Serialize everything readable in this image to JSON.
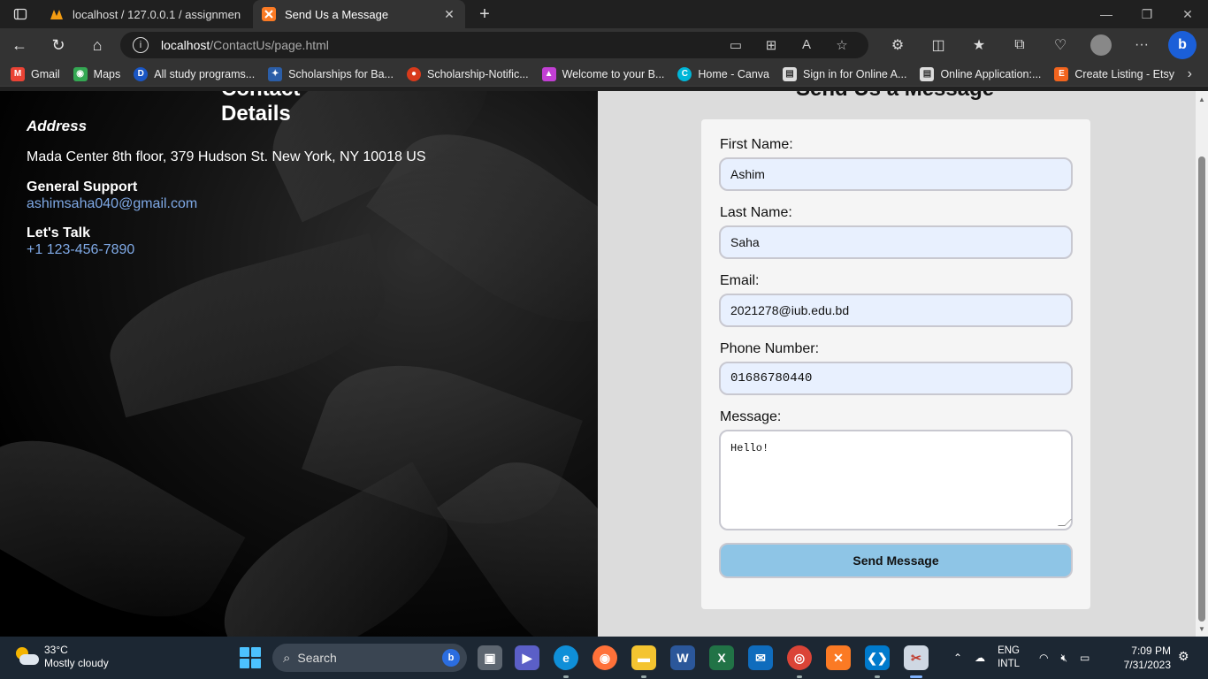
{
  "browser": {
    "tabs": [
      {
        "title": "localhost / 127.0.0.1 / assignmen",
        "active": false
      },
      {
        "title": "Send Us a Message",
        "active": true
      }
    ],
    "new_tab_symbol": "+",
    "close_symbol": "✕",
    "address": {
      "host": "localhost",
      "path": "/ContactUs/page.html"
    },
    "bookmarks": [
      {
        "label": "Gmail",
        "icon": "gmail-icon",
        "color": "#ea4335",
        "glyph": "M"
      },
      {
        "label": "Maps",
        "icon": "maps-pin-icon",
        "color": "#34a853",
        "glyph": "◉"
      },
      {
        "label": "All study programs...",
        "icon": "d-icon",
        "color": "#1a56c4",
        "glyph": "D"
      },
      {
        "label": "Scholarships for Ba...",
        "icon": "scholarship-icon",
        "color": "#2b5ea8",
        "glyph": "✦"
      },
      {
        "label": "Scholarship-Notific...",
        "icon": "notification-icon",
        "color": "#d83a1b",
        "glyph": "●"
      },
      {
        "label": "Welcome to your B...",
        "icon": "welcome-icon",
        "color": "#c23fd4",
        "glyph": "▲"
      },
      {
        "label": "Home - Canva",
        "icon": "canva-icon",
        "color": "#00b6d8",
        "glyph": "C"
      },
      {
        "label": "Sign in for Online A...",
        "icon": "signin-icon",
        "color": "#dddddd",
        "glyph": "▤"
      },
      {
        "label": "Online Application:...",
        "icon": "application-icon",
        "color": "#dddddd",
        "glyph": "▤"
      },
      {
        "label": "Create Listing - Etsy",
        "icon": "etsy-icon",
        "color": "#f1641e",
        "glyph": "E"
      }
    ]
  },
  "page": {
    "contact": {
      "title": "Contact Details",
      "address_label": "Address",
      "address": "Mada Center 8th floor, 379 Hudson St. New York, NY 10018 US",
      "support_label": "General Support",
      "support_email": "ashimsaha040@gmail.com",
      "talk_label": "Let's Talk",
      "talk_phone": "+1 123-456-7890"
    },
    "form": {
      "title": "Send Us a Message",
      "first_name_label": "First Name:",
      "first_name_value": "Ashim",
      "last_name_label": "Last Name:",
      "last_name_value": "Saha",
      "email_label": "Email:",
      "email_value": "2021278@iub.edu.bd",
      "phone_label": "Phone Number:",
      "phone_value": "01686780440",
      "message_label": "Message:",
      "message_value": "Hello!",
      "submit_label": "Send Message"
    }
  },
  "taskbar": {
    "weather_temp": "33°C",
    "weather_desc": "Mostly cloudy",
    "search_placeholder": "Search",
    "lang_line1": "ENG",
    "lang_line2": "INTL",
    "time": "7:09 PM",
    "date": "7/31/2023"
  }
}
